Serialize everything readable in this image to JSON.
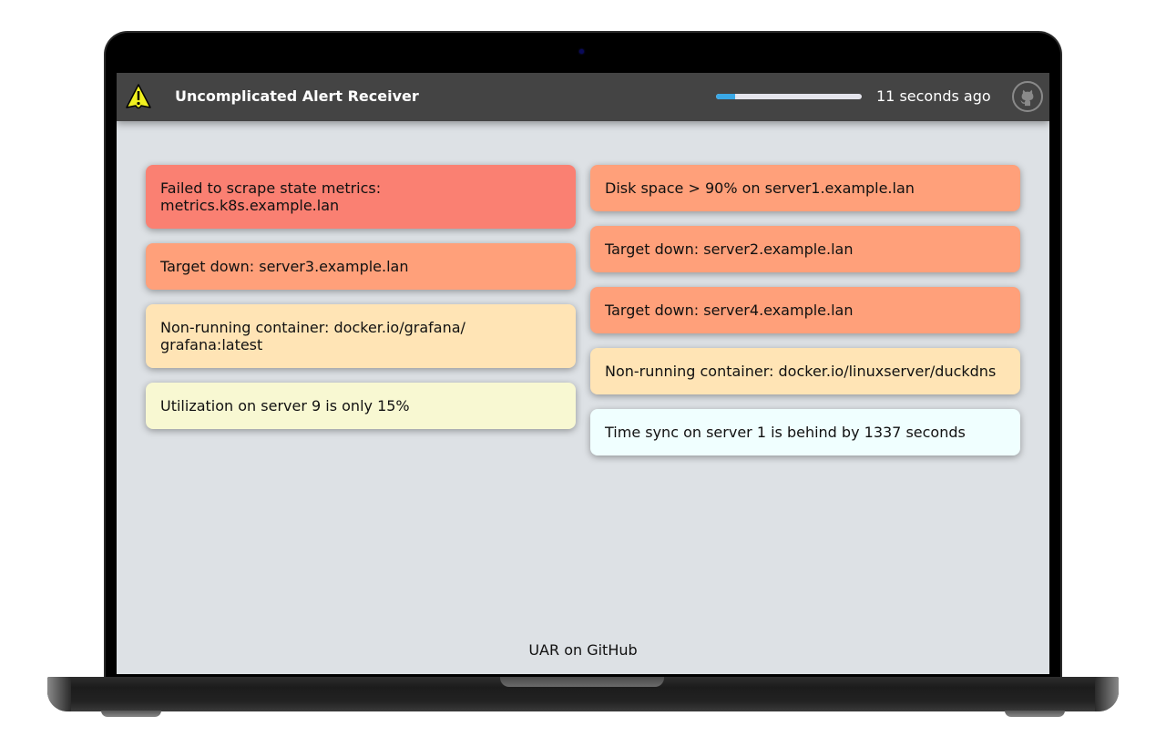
{
  "app": {
    "title": "Uncomplicated Alert Receiver",
    "logo_icon": "warning-triangle-icon",
    "refresh_progress_percent": 13,
    "last_updated": "11 seconds ago",
    "github_icon": "github-icon"
  },
  "colors": {
    "header_bg": "#444444",
    "page_bg": "#dde1e5",
    "progress_fill": "#3aa8e6",
    "progress_track": "#e4e4ec",
    "critical": "#fa8072",
    "error": "#ffa07a",
    "warning": "#ffe4b5",
    "info": "#fafad2",
    "debug": "#f0ffff"
  },
  "alerts": {
    "left": [
      {
        "text": "Failed to scrape state metrics: metrics.k8s.example.lan",
        "severity": "critical",
        "color": "#fa8072"
      },
      {
        "text": "Target down: server3.example.lan",
        "severity": "error",
        "color": "#ffa07a"
      },
      {
        "text": "Non-running container: docker.io/grafana/ grafana:latest",
        "severity": "warning",
        "color": "#ffe4b5"
      },
      {
        "text": "Utilization on server 9 is only 15%",
        "severity": "info",
        "color": "#f8f8d2"
      }
    ],
    "right": [
      {
        "text": "Disk space > 90% on server1.example.lan",
        "severity": "error",
        "color": "#ffa07a"
      },
      {
        "text": "Target down: server2.example.lan",
        "severity": "error",
        "color": "#ffa07a"
      },
      {
        "text": "Target down: server4.example.lan",
        "severity": "error",
        "color": "#ffa07a"
      },
      {
        "text": "Non-running container: docker.io/linuxserver/duckdns",
        "severity": "warning",
        "color": "#ffe4b5"
      },
      {
        "text": "Time sync on server 1 is behind by 1337 seconds",
        "severity": "debug",
        "color": "#f0ffff"
      }
    ]
  },
  "footer": {
    "link_label": "UAR on GitHub"
  }
}
